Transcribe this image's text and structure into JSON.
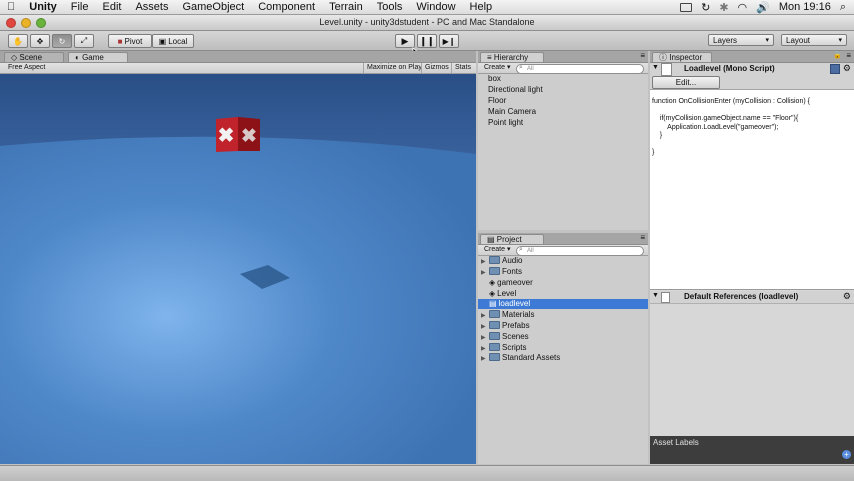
{
  "menubar": {
    "items": [
      "Unity",
      "File",
      "Edit",
      "Assets",
      "GameObject",
      "Component",
      "Terrain",
      "Tools",
      "Window",
      "Help"
    ],
    "clock": "Mon 19:16"
  },
  "window": {
    "title": "Level.unity - unity3dstudent - PC and Mac Standalone"
  },
  "toolbar": {
    "pivot_label": "Pivot",
    "local_label": "Local",
    "layers_label": "Layers",
    "layout_label": "Layout"
  },
  "scene_panel": {
    "tabs": [
      "Scene",
      "Game"
    ],
    "aspect_label": "Free Aspect",
    "maximize_label": "Maximize on Play",
    "gizmos_label": "Gizmos",
    "stats_label": "Stats"
  },
  "hierarchy": {
    "tab_label": "Hierarchy",
    "create_label": "Create",
    "search_placeholder": "All",
    "items": [
      "box",
      "Directional light",
      "Floor",
      "Main Camera",
      "Point light"
    ]
  },
  "project": {
    "tab_label": "Project",
    "create_label": "Create",
    "search_placeholder": "All",
    "items": [
      {
        "label": "Audio",
        "kind": "folder"
      },
      {
        "label": "Fonts",
        "kind": "folder"
      },
      {
        "label": "gameover",
        "kind": "scene"
      },
      {
        "label": "Level",
        "kind": "scene"
      },
      {
        "label": "loadlevel",
        "kind": "script",
        "selected": true
      },
      {
        "label": "Materials",
        "kind": "folder"
      },
      {
        "label": "Prefabs",
        "kind": "folder"
      },
      {
        "label": "Scenes",
        "kind": "folder"
      },
      {
        "label": "Scripts",
        "kind": "folder"
      },
      {
        "label": "Standard Assets",
        "kind": "folder"
      }
    ]
  },
  "inspector": {
    "tab_label": "Inspector",
    "header_title": "Loadlevel",
    "header_type": "(Mono Script)",
    "edit_label": "Edit...",
    "code": [
      "function OnCollisionEnter (myCollision : Collision) {",
      "",
      "    if(myCollision.gameObject.name == \"Floor\"){",
      "        Application.LoadLevel(\"gameover\");",
      "    }",
      "",
      "}"
    ],
    "default_refs": "Default References (loadlevel)",
    "asset_labels": "Asset Labels"
  },
  "colors": {
    "sky_top": "#2a4f86",
    "sky_bottom": "#4f7fbf",
    "floor": "#4a82c4",
    "crate": "#c0232b",
    "selection": "#3d7ad6"
  }
}
